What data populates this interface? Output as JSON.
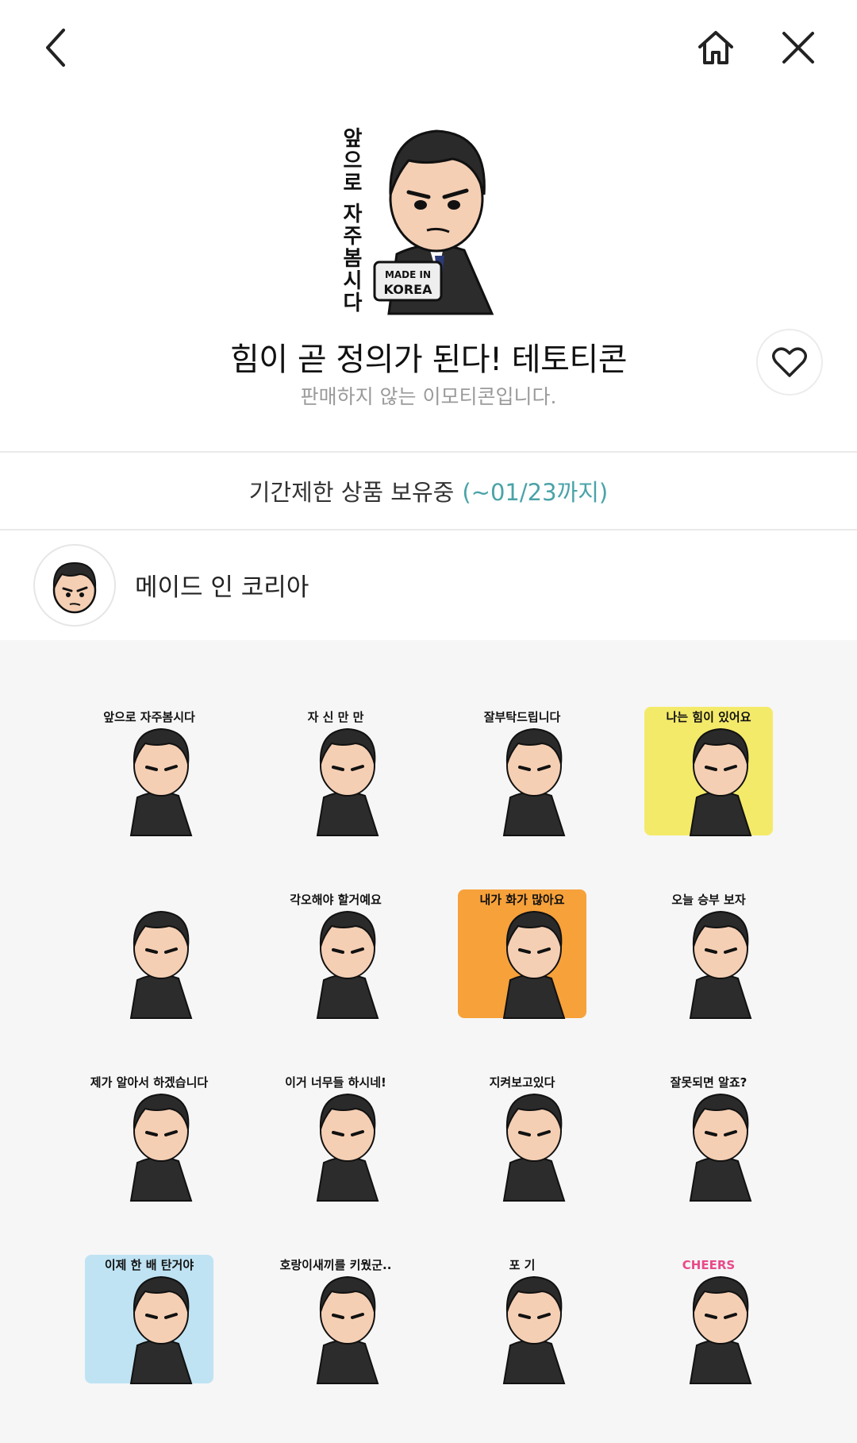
{
  "header": {
    "back_icon": "chevron-left-icon",
    "home_icon": "home-icon",
    "close_icon": "close-icon"
  },
  "product": {
    "hero_caption": "앞으로 자주봄시다",
    "hero_badge_line1": "MADE IN",
    "hero_badge_line2": "KOREA",
    "title": "힘이 곧 정의가 된다! 테토티콘",
    "subtitle": "판매하지 않는 이모티콘입니다.",
    "like_icon": "heart-outline-icon"
  },
  "limited": {
    "label": "기간제한 상품 보유중",
    "until": "(~01/23까지)"
  },
  "author": {
    "name": "메이드 인 코리아"
  },
  "stickers": [
    {
      "caption": "앞으로 자주봄시다",
      "bg": "none"
    },
    {
      "caption": "자 신 만 만",
      "bg": "none"
    },
    {
      "caption": "잘부탁드립니다",
      "bg": "none"
    },
    {
      "caption": "나는 힘이 있어요",
      "bg": "#f4ea6a"
    },
    {
      "caption": "",
      "bg": "none"
    },
    {
      "caption": "각오해야 할거예요",
      "bg": "none"
    },
    {
      "caption": "내가 화가 많아요",
      "bg": "#f7a13a"
    },
    {
      "caption": "오늘 승부 보자",
      "bg": "none"
    },
    {
      "caption": "제가 알아서 하겠습니다",
      "bg": "none"
    },
    {
      "caption": "이거 너무들 하시네!",
      "bg": "none"
    },
    {
      "caption": "지켜보고있다",
      "bg": "none"
    },
    {
      "caption": "잘못되면 알죠?",
      "bg": "none"
    },
    {
      "caption": "이제 한 배 탄거야",
      "bg": "#bfe3f3"
    },
    {
      "caption": "호랑이새끼를 키웠군..",
      "bg": "none"
    },
    {
      "caption": "포 기",
      "bg": "none"
    },
    {
      "caption": "CHEERS",
      "bg": "none"
    }
  ],
  "colors": {
    "accent_teal": "#4aa3a8",
    "grid_bg": "#f6f6f6",
    "divider": "#e9e9e9"
  }
}
